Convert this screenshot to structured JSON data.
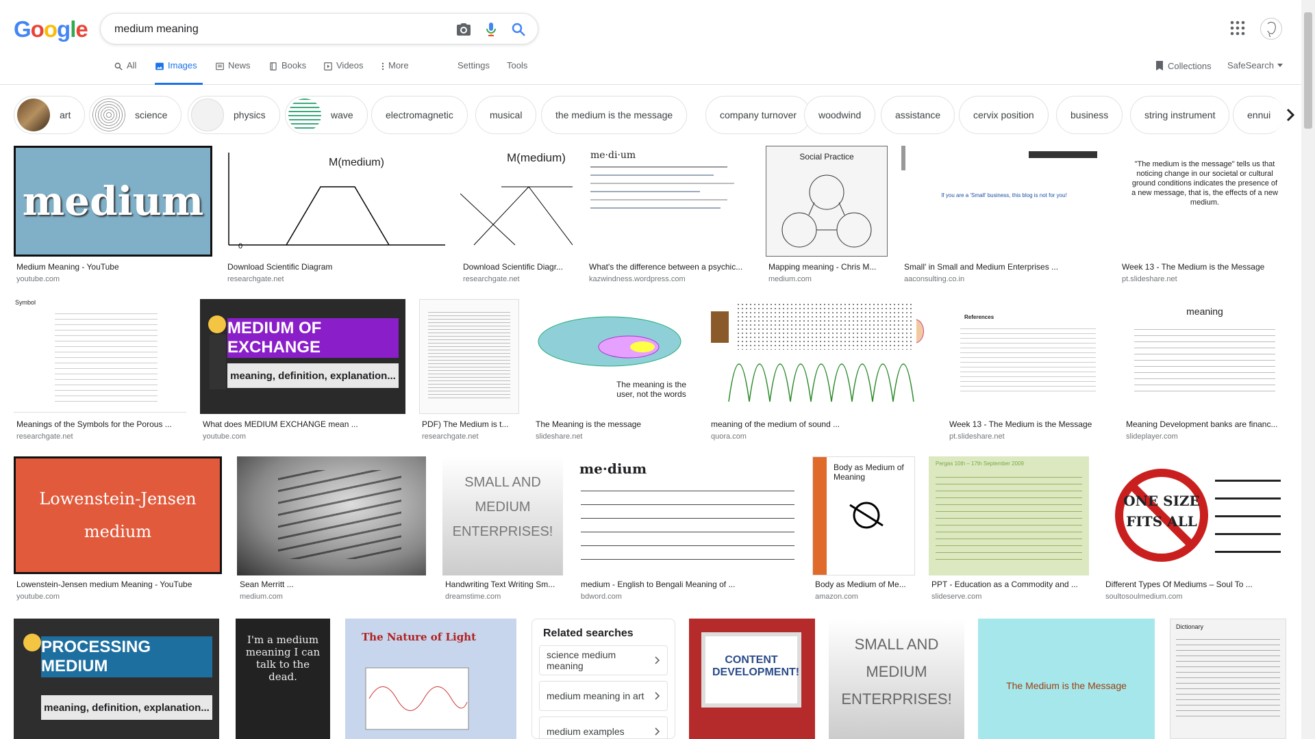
{
  "search": {
    "query": "medium meaning"
  },
  "tabs": [
    {
      "label": "All",
      "icon": "search-icon"
    },
    {
      "label": "Images",
      "icon": "image-icon",
      "active": true
    },
    {
      "label": "News",
      "icon": "news-icon"
    },
    {
      "label": "Books",
      "icon": "book-icon"
    },
    {
      "label": "Videos",
      "icon": "video-icon"
    },
    {
      "label": "More",
      "icon": "more-vert-icon"
    }
  ],
  "tools": {
    "settings": "Settings",
    "tools": "Tools",
    "collections": "Collections",
    "safesearch": "SafeSearch"
  },
  "chips": [
    "art",
    "science",
    "physics",
    "wave",
    "electromagnetic",
    "musical",
    "the medium is the message",
    "company turnover",
    "woodwind",
    "assistance",
    "cervix position",
    "business",
    "string instrument",
    "ennui"
  ],
  "results": [
    {
      "title": "Medium Meaning - YouTube",
      "source": "youtube.com",
      "img_text": "medium"
    },
    {
      "title": "Download Scientific Diagram",
      "source": "researchgate.net",
      "img_text": "M(medium)"
    },
    {
      "title": "Download Scientific Diagr...",
      "source": "researchgate.net",
      "img_text": "M(medium)"
    },
    {
      "title": "What's the difference between a psychic...",
      "source": "kazwindness.wordpress.com",
      "img_text": "me·di·um"
    },
    {
      "title": "Mapping meaning - Chris M...",
      "source": "medium.com",
      "img_text": "Social Practice"
    },
    {
      "title": "Small' in Small and Medium Enterprises ...",
      "source": "aaconsulting.co.in",
      "img_text": "If you are a 'Small' business, this blog is not for you!"
    },
    {
      "title": "Week 13 - The Medium is the Message",
      "source": "pt.slideshare.net",
      "img_text": "\"The medium is the message\" tells us that noticing change in our societal or cultural ground conditions indicates the presence of a new message, that is, the effects of a new medium."
    },
    {
      "title": "Meanings of the Symbols for the Porous ...",
      "source": "researchgate.net",
      "img_text": "Symbol"
    },
    {
      "title": "What does MEDIUM EXCHANGE mean ...",
      "source": "youtube.com",
      "img_text": "MEDIUM OF EXCHANGE"
    },
    {
      "title": "PDF) The Medium is t...",
      "source": "researchgate.net",
      "img_text": ""
    },
    {
      "title": "The Meaning is the message",
      "source": "slideshare.net",
      "img_text": "The meaning is the user, not the words"
    },
    {
      "title": "meaning of the medium of sound ...",
      "source": "quora.com",
      "img_text": ""
    },
    {
      "title": "Week 13 - The Medium is the Message",
      "source": "pt.slideshare.net",
      "img_text": "References"
    },
    {
      "title": "Meaning Development banks are financ...",
      "source": "slideplayer.com",
      "img_text": "meaning"
    },
    {
      "title": "Lowenstein-Jensen medium Meaning - YouTube",
      "source": "youtube.com",
      "img_text": "Lowenstein-Jensen medium"
    },
    {
      "title": "Sean Merritt ...",
      "source": "medium.com",
      "img_text": ""
    },
    {
      "title": "Handwriting Text Writing Sm...",
      "source": "dreamstime.com",
      "img_text": "SMALL AND MEDIUM ENTERPRISES!"
    },
    {
      "title": "medium - English to Bengali Meaning of ...",
      "source": "bdword.com",
      "img_text": "me·dium"
    },
    {
      "title": "Body as Medium of Me...",
      "source": "amazon.com",
      "img_text": "Body as Medium of Meaning"
    },
    {
      "title": "PPT - Education as a Commodity and ...",
      "source": "slideserve.com",
      "img_text": "Pergas 10th – 17th September 2009"
    },
    {
      "title": "Different Types Of Mediums – Soul To ...",
      "source": "soultosoulmedium.com",
      "img_text": "ONE SIZE FITS ALL"
    },
    {
      "title": "",
      "source": "",
      "img_text": "PROCESSING MEDIUM"
    },
    {
      "title": "",
      "source": "",
      "img_text": "I'm a medium meaning I can talk to the dead."
    },
    {
      "title": "",
      "source": "",
      "img_text": "The Nature of Light"
    },
    {
      "title": "",
      "source": "",
      "img_text": "CONTENT DEVELOPMENT!"
    },
    {
      "title": "",
      "source": "",
      "img_text": "SMALL AND MEDIUM ENTERPRISES!"
    },
    {
      "title": "",
      "source": "",
      "img_text": "The Medium is the Message"
    },
    {
      "title": "",
      "source": "",
      "img_text": "Dictionary"
    }
  ],
  "related": {
    "heading": "Related searches",
    "items": [
      "science medium meaning",
      "medium meaning in art",
      "medium examples"
    ]
  },
  "extra_text": {
    "exchange_sub": "meaning, definition, explanation...",
    "processing_sub": "meaning, definition, explanation..."
  }
}
